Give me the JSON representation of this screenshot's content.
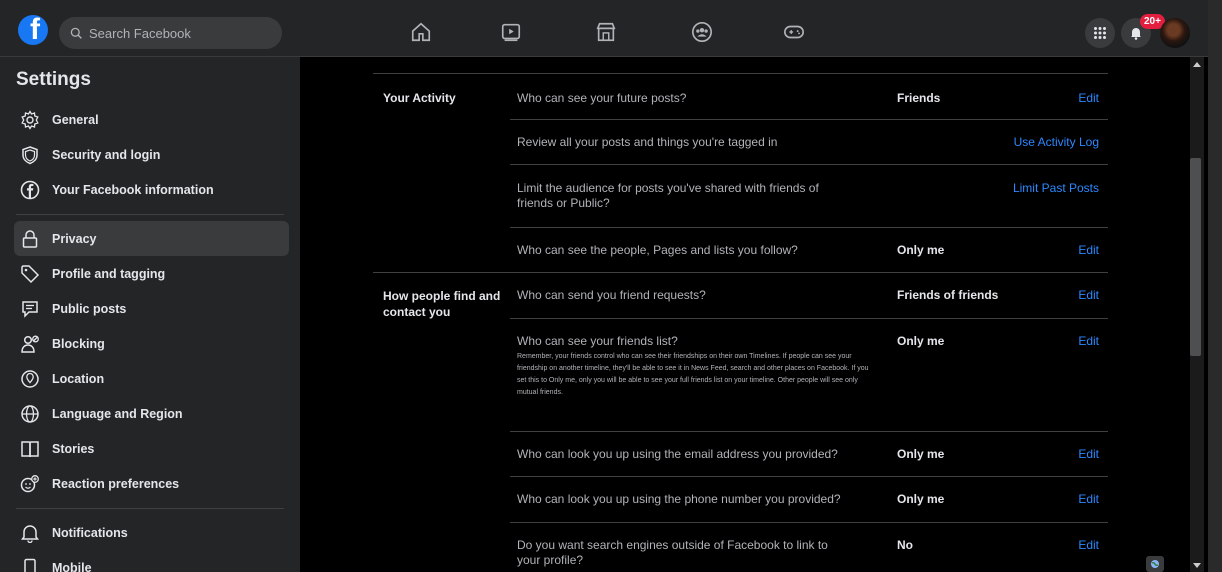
{
  "topbar": {
    "search_placeholder": "Search Facebook",
    "logo_letter": "f",
    "notification_badge": "20+",
    "nav_icons": [
      "home-icon",
      "watch-icon",
      "marketplace-icon",
      "groups-icon",
      "gaming-icon"
    ]
  },
  "sidebar": {
    "title": "Settings",
    "items": [
      {
        "label": "General",
        "icon": "gear-icon"
      },
      {
        "label": "Security and login",
        "icon": "shield-icon"
      },
      {
        "label": "Your Facebook information",
        "icon": "facebook-icon"
      },
      {
        "label": "Privacy",
        "icon": "lock-icon"
      },
      {
        "label": "Profile and tagging",
        "icon": "tag-icon"
      },
      {
        "label": "Public posts",
        "icon": "public-posts-icon"
      },
      {
        "label": "Blocking",
        "icon": "blocking-icon"
      },
      {
        "label": "Location",
        "icon": "location-icon"
      },
      {
        "label": "Language and Region",
        "icon": "globe-icon"
      },
      {
        "label": "Stories",
        "icon": "stories-icon"
      },
      {
        "label": "Reaction preferences",
        "icon": "reaction-icon"
      },
      {
        "label": "Notifications",
        "icon": "bell-icon"
      },
      {
        "label": "Mobile",
        "icon": "mobile-icon"
      }
    ]
  },
  "main": {
    "your_activity": {
      "title": "Your Activity",
      "rows": [
        {
          "question": "Who can see your future posts?",
          "value": "Friends",
          "action": "Edit"
        },
        {
          "question": "Review all your posts and things you're tagged in",
          "value": "",
          "action": "Use Activity Log"
        },
        {
          "question": "Limit the audience for posts you've shared with friends of friends or Public?",
          "value": "",
          "action": "Limit Past Posts"
        },
        {
          "question": "Who can see the people, Pages and lists you follow?",
          "value": "Only me",
          "action": "Edit"
        }
      ]
    },
    "find_contact": {
      "title": "How people find and contact you",
      "rows": [
        {
          "question": "Who can send you friend requests?",
          "value": "Friends of friends",
          "action": "Edit"
        },
        {
          "question": "Who can see your friends list?",
          "note": "Remember, your friends control who can see their friendships on their own Timelines. If people can see your friendship on another timeline, they'll be able to see it in News Feed, search and other places on Facebook. If you set this to Only me, only you will be able to see your full friends list on your timeline. Other people will see only mutual friends.",
          "value": "Only me",
          "action": "Edit"
        },
        {
          "question": "Who can look you up using the email address you provided?",
          "value": "Only me",
          "action": "Edit"
        },
        {
          "question": "Who can look you up using the phone number you provided?",
          "value": "Only me",
          "action": "Edit"
        },
        {
          "question": "Do you want search engines outside of Facebook to link to your profile?",
          "value": "No",
          "action": "Edit"
        }
      ]
    }
  },
  "colors": {
    "accent": "#2d88ff",
    "brand": "#1877f2",
    "badge": "#e41e3f"
  }
}
